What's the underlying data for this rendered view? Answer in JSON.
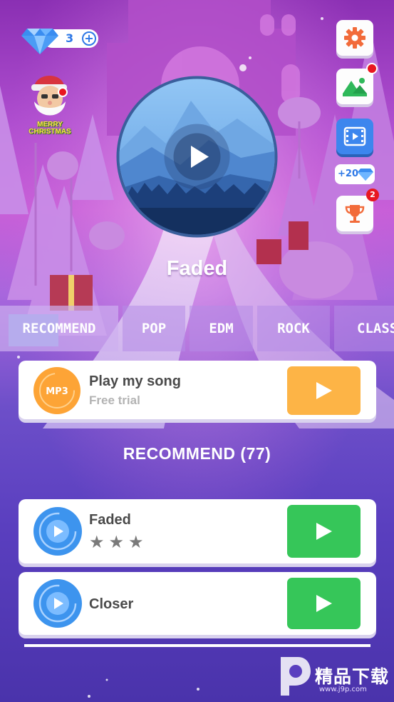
{
  "status": {
    "gem_count": "3",
    "add_label": "+"
  },
  "christmas_badge": {
    "line1": "MERRY",
    "line2": "CHRISTMAS"
  },
  "side_buttons": {
    "settings_icon": "gear-icon",
    "theme_icon": "landscape-icon",
    "video_icon": "film-play-icon",
    "reward_text": "+20",
    "trophy_badge": "2"
  },
  "now_playing": {
    "title": "Faded"
  },
  "tabs": [
    {
      "label": "RECOMMEND",
      "active": true
    },
    {
      "label": "POP",
      "active": false
    },
    {
      "label": "EDM",
      "active": false
    },
    {
      "label": "ROCK",
      "active": false
    },
    {
      "label": "CLASS",
      "active": false
    }
  ],
  "custom_song": {
    "icon_label": "MP3",
    "title": "Play my song",
    "subtitle": "Free trial"
  },
  "section": {
    "title": "RECOMMEND (77)"
  },
  "songs": [
    {
      "title": "Faded",
      "stars": 3
    },
    {
      "title": "Closer",
      "stars": 0
    }
  ],
  "watermark": {
    "text": "精品下载",
    "url": "www.j9p.com"
  },
  "colors": {
    "accent_blue": "#2e78e6",
    "play_orange": "#fdb446",
    "play_green": "#36c659",
    "badge_red": "#e8171f",
    "settings_orange": "#f26b3a"
  }
}
